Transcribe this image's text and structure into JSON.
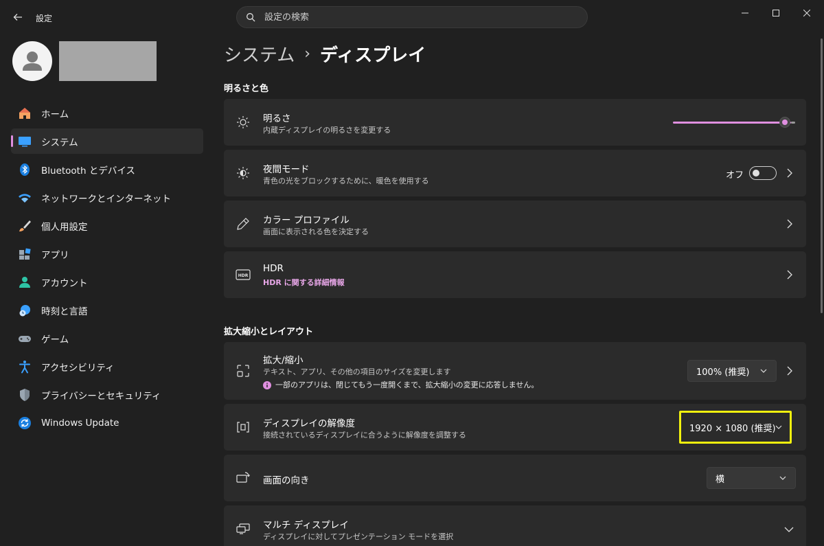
{
  "app": {
    "title": "設定"
  },
  "search": {
    "placeholder": "設定の検索"
  },
  "sidebar": {
    "items": [
      {
        "label": "ホーム",
        "icon": "home-icon"
      },
      {
        "label": "システム",
        "icon": "system-icon",
        "selected": true
      },
      {
        "label": "Bluetooth とデバイス",
        "icon": "bluetooth-icon"
      },
      {
        "label": "ネットワークとインターネット",
        "icon": "wifi-icon"
      },
      {
        "label": "個人用設定",
        "icon": "brush-icon"
      },
      {
        "label": "アプリ",
        "icon": "apps-icon"
      },
      {
        "label": "アカウント",
        "icon": "account-icon"
      },
      {
        "label": "時刻と言語",
        "icon": "globe-clock-icon"
      },
      {
        "label": "ゲーム",
        "icon": "gamepad-icon"
      },
      {
        "label": "アクセシビリティ",
        "icon": "accessibility-icon"
      },
      {
        "label": "プライバシーとセキュリティ",
        "icon": "shield-icon"
      },
      {
        "label": "Windows Update",
        "icon": "update-icon"
      }
    ]
  },
  "breadcrumb": {
    "parent": "システム",
    "separator": "›",
    "current": "ディスプレイ"
  },
  "sections": {
    "brightness_color": "明るさと色",
    "scale_layout": "拡大縮小とレイアウト"
  },
  "cards": {
    "brightness": {
      "title": "明るさ",
      "subtitle": "内蔵ディスプレイの明るさを変更する",
      "level": 0.97
    },
    "night_mode": {
      "title": "夜間モード",
      "subtitle": "青色の光をブロックするために、暖色を使用する",
      "state": "オフ"
    },
    "color_profile": {
      "title": "カラー プロファイル",
      "subtitle": "画面に表示される色を決定する"
    },
    "hdr": {
      "title": "HDR",
      "link": "HDR に関する詳細情報"
    },
    "scale": {
      "title": "拡大/縮小",
      "subtitle": "テキスト、アプリ、その他の項目のサイズを変更します",
      "note": "一部のアプリは、閉じてもう一度開くまで、拡大縮小の変更に応答しません。",
      "value": "100% (推奨)"
    },
    "resolution": {
      "title": "ディスプレイの解像度",
      "subtitle": "接続されているディスプレイに合うように解像度を調整する",
      "value": "1920 × 1080 (推奨)"
    },
    "orientation": {
      "title": "画面の向き",
      "value": "横"
    },
    "multi_display": {
      "title": "マルチ ディスプレイ",
      "subtitle": "ディスプレイに対してプレゼンテーション モードを選択"
    }
  },
  "colors": {
    "accent": "#e08fe0",
    "highlight": "#f2f20e",
    "background": "#202020",
    "card": "#2b2b2b"
  }
}
